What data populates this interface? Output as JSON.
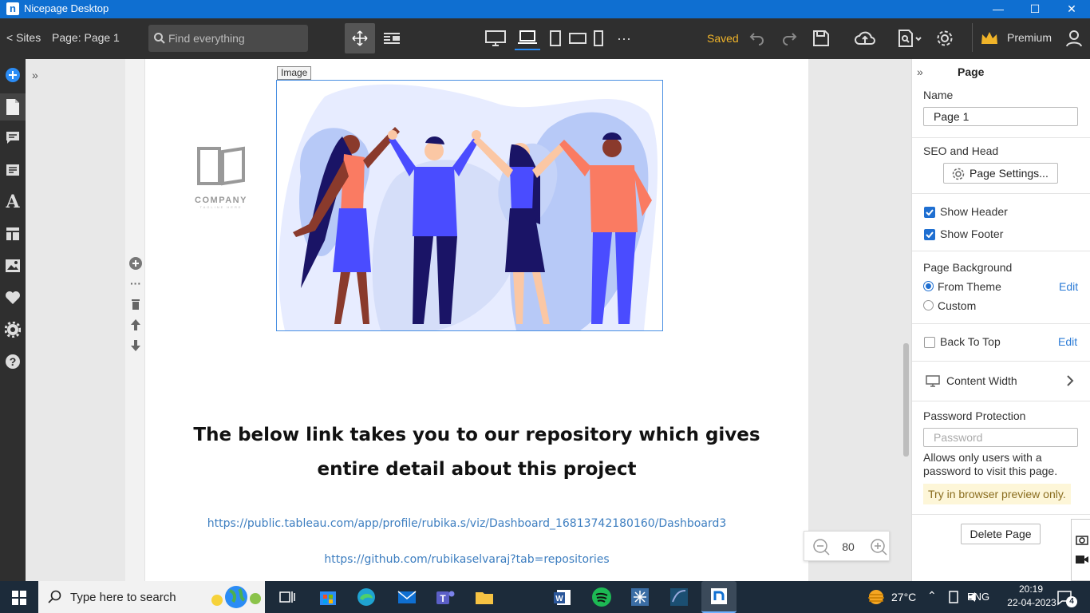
{
  "window": {
    "title": "Nicepage Desktop",
    "minimize": "—",
    "maximize": "☐",
    "close": "✕"
  },
  "toolbar": {
    "sites": "< Sites",
    "page_label": "Page: Page 1",
    "search_placeholder": "Find everything",
    "saved": "Saved",
    "premium": "Premium"
  },
  "canvas": {
    "image_tag": "Image",
    "logo_text": "COMPANY",
    "logo_subtext": "TAGLINE HERE",
    "heading": "The below link takes you to our repository which gives entire detail about this project",
    "link1": "https://public.tableau.com/app/profile/rubika.s/viz/Dashboard_16813742180160/Dashboard3",
    "link2": "https://github.com/rubikaselvaraj?tab=repositories",
    "zoom": "80"
  },
  "panel": {
    "title": "Page",
    "name_label": "Name",
    "name_value": "Page 1",
    "seo_label": "SEO and Head",
    "page_settings": "Page Settings...",
    "show_header": "Show Header",
    "show_footer": "Show Footer",
    "background_label": "Page Background",
    "from_theme": "From Theme",
    "custom": "Custom",
    "edit": "Edit",
    "back_to_top": "Back To Top",
    "content_width": "Content Width",
    "password_label": "Password Protection",
    "password_placeholder": "Password",
    "password_help": "Allows only users with a password to visit this page.",
    "try_preview": "Try in browser preview only.",
    "delete_page": "Delete Page"
  },
  "taskbar": {
    "search": "Type here to search",
    "temperature": "27°C",
    "language": "ENG",
    "time": "20:19",
    "date": "22-04-2023",
    "notifications": "4"
  },
  "colors": {
    "accent": "#1f6fd1",
    "saved": "#f0b429",
    "link": "#3d7ec0",
    "premium_crown": "#f0b429"
  }
}
